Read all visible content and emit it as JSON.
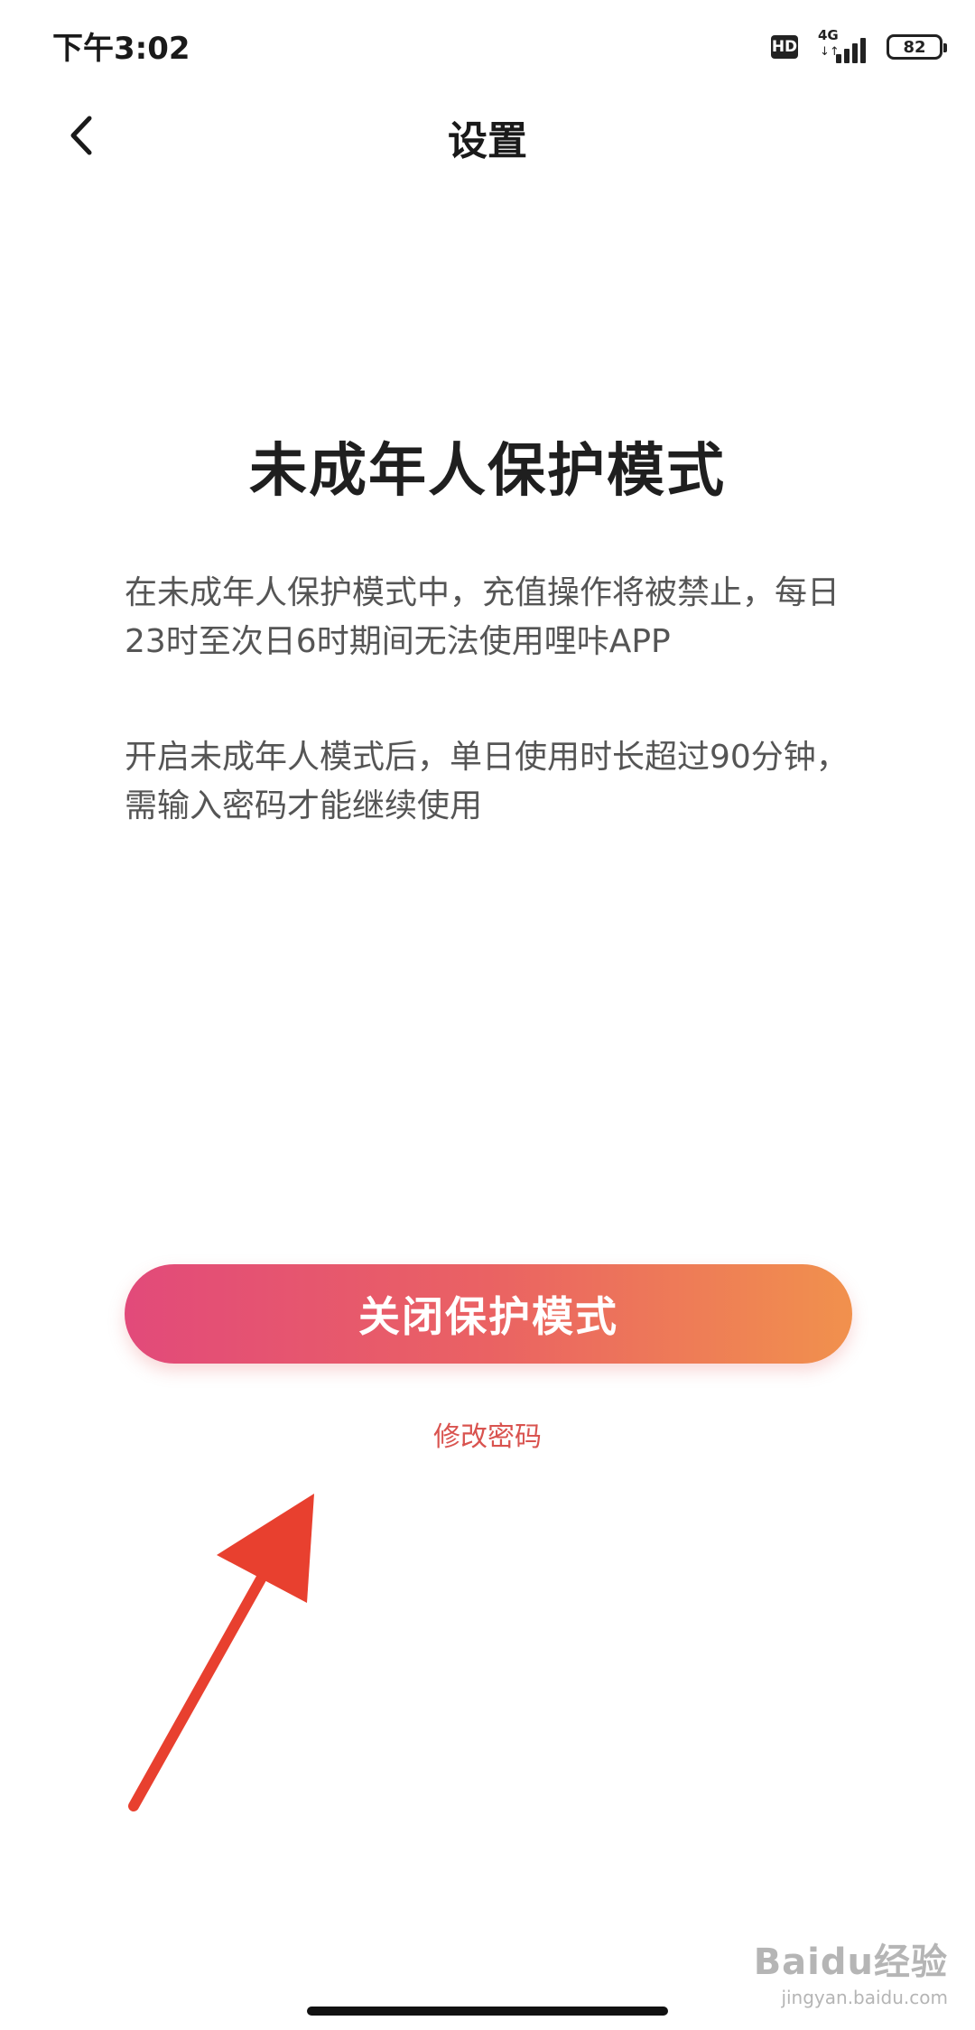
{
  "status_bar": {
    "time": "下午3:02",
    "hd_label": "HD",
    "network_label": "4G",
    "network_arrows": "↓↑",
    "battery_level": "82",
    "icons": [
      "hd-icon",
      "signal-icon",
      "battery-icon"
    ]
  },
  "nav": {
    "back_icon": "chevron-left-icon",
    "title": "设置"
  },
  "content": {
    "title": "未成年人保护模式",
    "paragraphs": [
      "在未成年人保护模式中，充值操作将被禁止，每日23时至次日6时期间无法使用哩咔APP",
      "开启未成年人模式后，单日使用时长超过90分钟，需输入密码才能继续使用"
    ]
  },
  "actions": {
    "primary_button_label": "关闭保护模式",
    "secondary_link_label": "修改密码"
  },
  "annotation": {
    "arrow_icon": "red-arrow-icon",
    "arrow_color": "#e8402f"
  },
  "watermark": {
    "logo": "Baidu经验",
    "url": "jingyan.baidu.com"
  },
  "colors": {
    "gradient_start": "#e24a7a",
    "gradient_end": "#f1914d",
    "link_color": "#d9534f"
  }
}
